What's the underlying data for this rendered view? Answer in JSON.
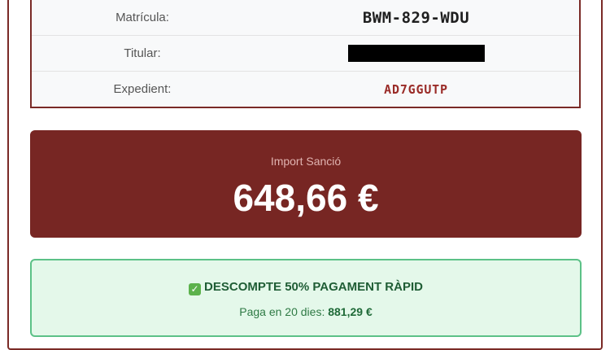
{
  "details": {
    "rows": [
      {
        "label": "Matrícula:",
        "value": "BWM-829-WDU"
      },
      {
        "label": "Titular:",
        "value": ""
      },
      {
        "label": "Expedient:",
        "value": "AD7GGUTP"
      }
    ]
  },
  "amount": {
    "label": "Import Sanció",
    "value": "648,66 €"
  },
  "discount": {
    "title": "DESCOMPTE 50% PAGAMENT RÀPID",
    "icon": "check-icon",
    "sub_prefix": "Paga en 20 dies:",
    "sub_amount": "881,29 €"
  },
  "colors": {
    "brand_dark_red": "#772623",
    "success_green_bg": "#e4f8ea",
    "success_green_border": "#5cc187"
  }
}
